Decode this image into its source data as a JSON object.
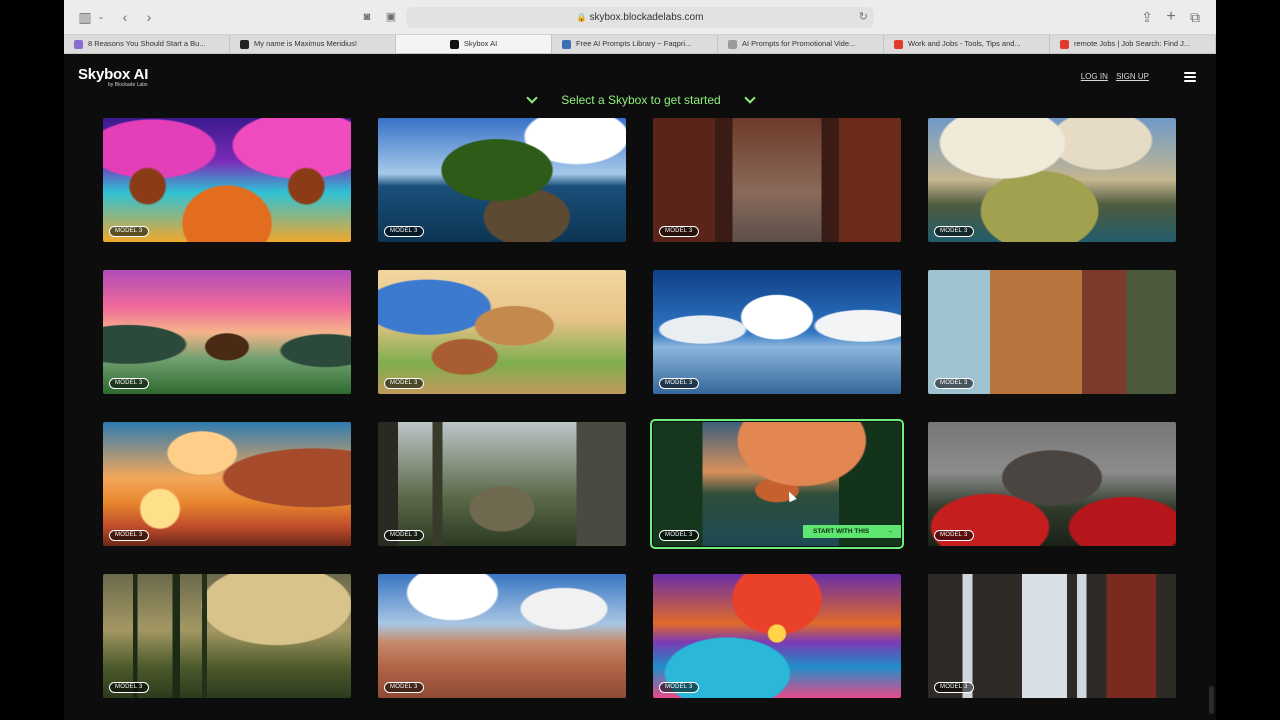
{
  "browser": {
    "url": "skybox.blockadelabs.com",
    "tabs": [
      {
        "label": "8 Reasons You Should Start a Bu...",
        "favicon_color": "#8a6bd1",
        "active": false
      },
      {
        "label": "My name is Maximus Meridius!",
        "favicon_color": "#222222",
        "active": false
      },
      {
        "label": "Skybox AI",
        "favicon_color": "#111111",
        "active": true
      },
      {
        "label": "Free AI Prompts Library ~ Faqpri...",
        "favicon_color": "#3b6fb6",
        "active": false
      },
      {
        "label": "AI Prompts for Promotional Vide...",
        "favicon_color": "#9b9b9b",
        "active": false
      },
      {
        "label": "Work and Jobs - Tools, Tips and...",
        "favicon_color": "#e23b2e",
        "active": false
      },
      {
        "label": "remote Jobs | Job Search: Find J...",
        "favicon_color": "#e23b2e",
        "active": false
      }
    ]
  },
  "site": {
    "logo": "Skybox AI",
    "logo_sub": "by Blockade Labs",
    "login": "LOG IN",
    "signup": "SIGN UP",
    "selector_text": "Select a Skybox to get started",
    "accent_color": "#8ff07a"
  },
  "gallery": {
    "badge": "MODEL 3",
    "start_label": "START WITH THIS",
    "selected_index": 10,
    "items": [
      {
        "scene": "psy-trees"
      },
      {
        "scene": "island"
      },
      {
        "scene": "ruins"
      },
      {
        "scene": "mesa"
      },
      {
        "scene": "pagoda"
      },
      {
        "scene": "tower"
      },
      {
        "scene": "clouds"
      },
      {
        "scene": "city"
      },
      {
        "scene": "canyon"
      },
      {
        "scene": "forest-ruin"
      },
      {
        "scene": "lake"
      },
      {
        "scene": "castle"
      },
      {
        "scene": "misty"
      },
      {
        "scene": "desert"
      },
      {
        "scene": "psy-lake"
      },
      {
        "scene": "interior"
      }
    ]
  }
}
